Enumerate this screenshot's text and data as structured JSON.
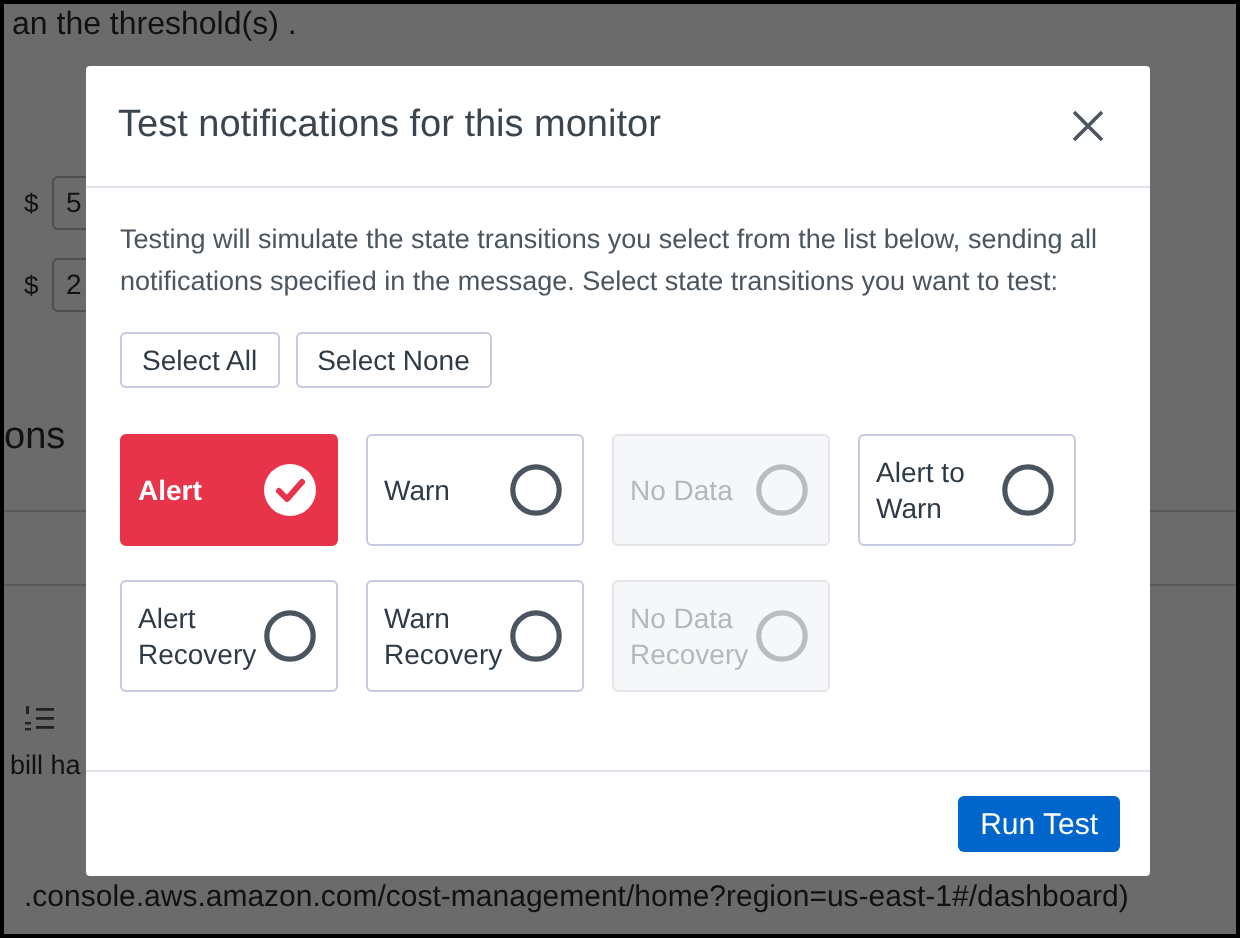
{
  "background_page": {
    "top_text": "an the threshold(s) .",
    "threshold_inputs": [
      {
        "currency": "$",
        "value": "5"
      },
      {
        "currency": "$",
        "value": "2"
      }
    ],
    "section_heading": "ons",
    "message_text": "bill ha",
    "message_link": ".console.aws.amazon.com/cost-management/home?region=us-east-1#/dashboard)"
  },
  "modal": {
    "title": "Test notifications for this monitor",
    "description": "Testing will simulate the state transitions you select from the list below, sending all notifications specified in the message. Select state transitions you want to test:",
    "select_buttons": [
      "Select All",
      "Select None"
    ],
    "options": [
      {
        "label": "Alert",
        "selected": true,
        "disabled": false
      },
      {
        "label": "Warn",
        "selected": false,
        "disabled": false
      },
      {
        "label": "No Data",
        "selected": false,
        "disabled": true
      },
      {
        "label": "Alert to Warn",
        "selected": false,
        "disabled": false
      },
      {
        "label": "Alert Recovery",
        "selected": false,
        "disabled": false
      },
      {
        "label": "Warn Recovery",
        "selected": false,
        "disabled": false
      },
      {
        "label": "No Data Recovery",
        "selected": false,
        "disabled": true
      }
    ],
    "primary_button": "Run Test"
  }
}
